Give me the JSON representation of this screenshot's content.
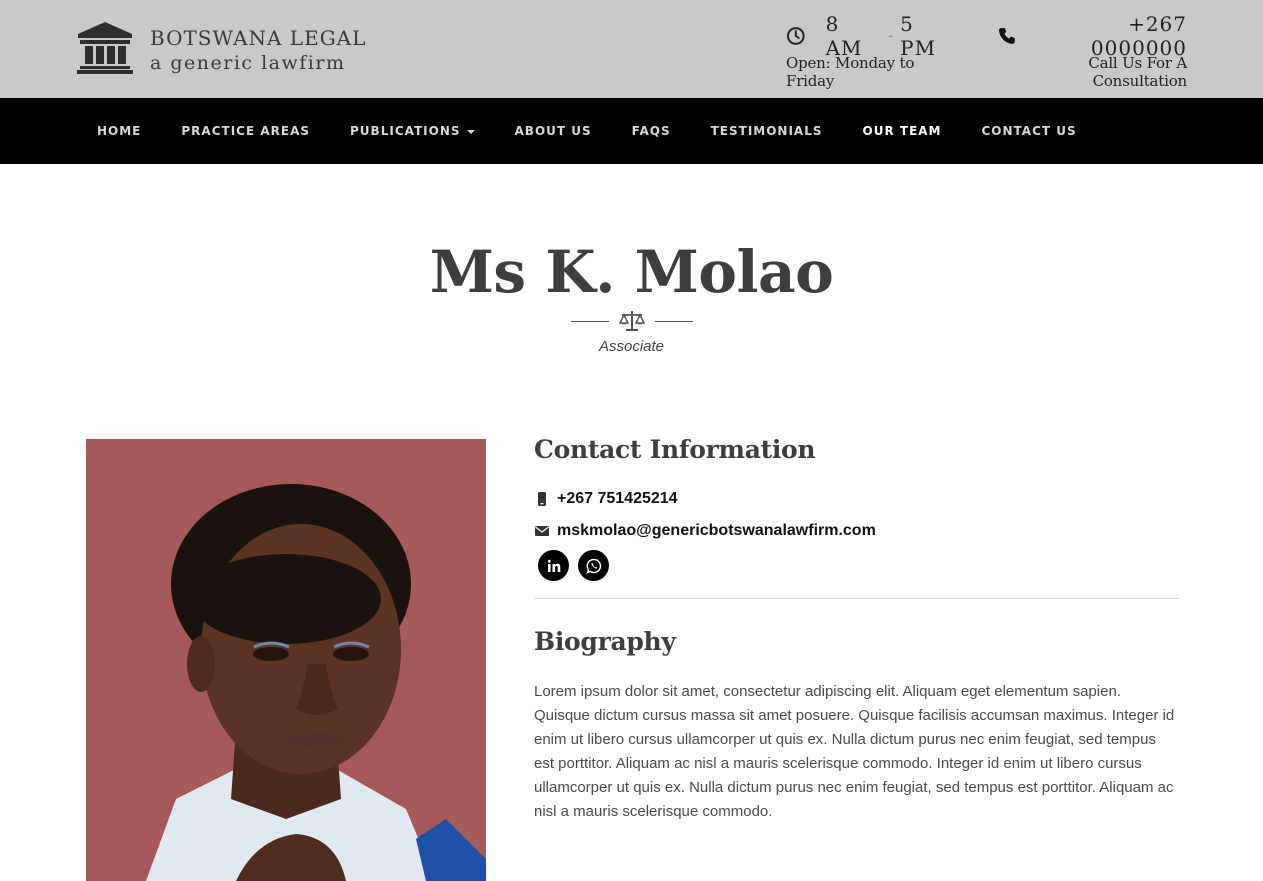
{
  "header": {
    "brand_title": "BOTSWANA LEGAL",
    "brand_subtitle": "a generic lawfirm",
    "hours_open": "8 AM",
    "hours_dash": "-",
    "hours_close": "5 PM",
    "hours_days": "Open: Monday to Friday",
    "phone": "+267 0000000",
    "phone_caption": "Call Us For A Consultation"
  },
  "nav": {
    "items": [
      {
        "label": "HOME"
      },
      {
        "label": "PRACTICE AREAS"
      },
      {
        "label": "PUBLICATIONS"
      },
      {
        "label": "ABOUT US"
      },
      {
        "label": "FAQS"
      },
      {
        "label": "TESTIMONIALS"
      },
      {
        "label": "OUR TEAM"
      },
      {
        "label": "CONTACT US"
      }
    ]
  },
  "profile": {
    "name": "Ms K. Molao",
    "role": "Associate"
  },
  "contact": {
    "heading": "Contact Information",
    "phone": "+267 751425214",
    "email": "mskmolao@genericbotswanalawfirm.com"
  },
  "biography": {
    "heading": "Biography",
    "text": "Lorem ipsum dolor sit amet, consectetur adipiscing elit. Aliquam eget elementum sapien. Quisque dictum cursus massa sit amet posuere. Quisque facilisis accumsan maximus. Integer id enim ut libero cursus ullamcorper ut quis ex. Nulla dictum purus nec enim feugiat, sed tempus est porttitor. Aliquam ac nisl a mauris scelerisque commodo. Integer id enim ut libero cursus ullamcorper ut quis ex. Nulla dictum purus nec enim feugiat, sed tempus est porttitor. Aliquam ac nisl a mauris scelerisque commodo."
  },
  "icons": {
    "logo": "courthouse-icon",
    "hours": "clock-icon",
    "phone": "phone-icon",
    "divider": "scales-icon",
    "mobile": "mobile-phone-icon",
    "email": "envelope-icon",
    "social": [
      "linkedin-icon",
      "whatsapp-icon"
    ]
  },
  "colors": {
    "header_bg": "#c9c9c9",
    "nav_bg": "#000000",
    "text_dark": "#3e3e3e"
  }
}
